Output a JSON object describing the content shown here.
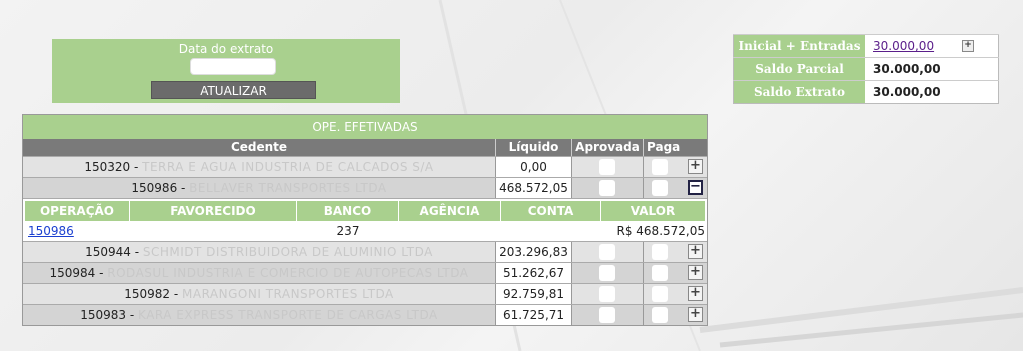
{
  "date_panel": {
    "label": "Data do extrato",
    "date_value": "",
    "update_button": "ATUALIZAR"
  },
  "summary": [
    {
      "label": "Inicial + Entradas",
      "value": "30.000,00",
      "is_link": true
    },
    {
      "label": "Saldo Parcial",
      "value": "30.000,00",
      "is_link": false
    },
    {
      "label": "Saldo Extrato",
      "value": "30.000,00",
      "is_link": false
    }
  ],
  "table": {
    "caption": "OPE. EFETIVADAS",
    "headers": {
      "cedente": "Cedente",
      "liquido": "Líquido",
      "aprovada": "Aprovada",
      "paga": "Paga"
    },
    "rows": [
      {
        "id": "150320",
        "name": "TERRA E AGUA INDUSTRIA DE CALCADOS S/A",
        "liquido": "0,00",
        "expanded": false
      },
      {
        "id": "150986",
        "name": "BELLAVER TRANSPORTES LTDA",
        "liquido": "468.572,05",
        "expanded": true
      },
      {
        "id": "150944",
        "name": "SCHMIDT DISTRIBUIDORA DE ALUMINIO LTDA",
        "liquido": "203.296,83",
        "expanded": false
      },
      {
        "id": "150984",
        "name": "RODASUL INDUSTRIA E COMERCIO DE AUTOPECAS LTDA",
        "liquido": "51.262,67",
        "expanded": false
      },
      {
        "id": "150982",
        "name": "MARANGONI TRANSPORTES LTDA",
        "liquido": "92.759,81",
        "expanded": false
      },
      {
        "id": "150983",
        "name": "KARA EXPRESS TRANSPORTE DE CARGAS LTDA",
        "liquido": "61.725,71",
        "expanded": false
      }
    ],
    "detail": {
      "headers": {
        "operacao": "OPERAÇÃO",
        "favorecido": "FAVORECIDO",
        "banco": "BANCO",
        "agencia": "AGÊNCIA",
        "conta": "CONTA",
        "valor": "VALOR"
      },
      "row": {
        "operacao": "150986",
        "favorecido": "",
        "banco": "237",
        "agencia": "",
        "conta": "",
        "valor": "R$ 468.572,05"
      }
    }
  },
  "colors": {
    "green": "#a9d08e",
    "header_gray": "#7a7a7a",
    "button_gray": "#6b6b6b",
    "link_purple": "#5a1e8a"
  }
}
